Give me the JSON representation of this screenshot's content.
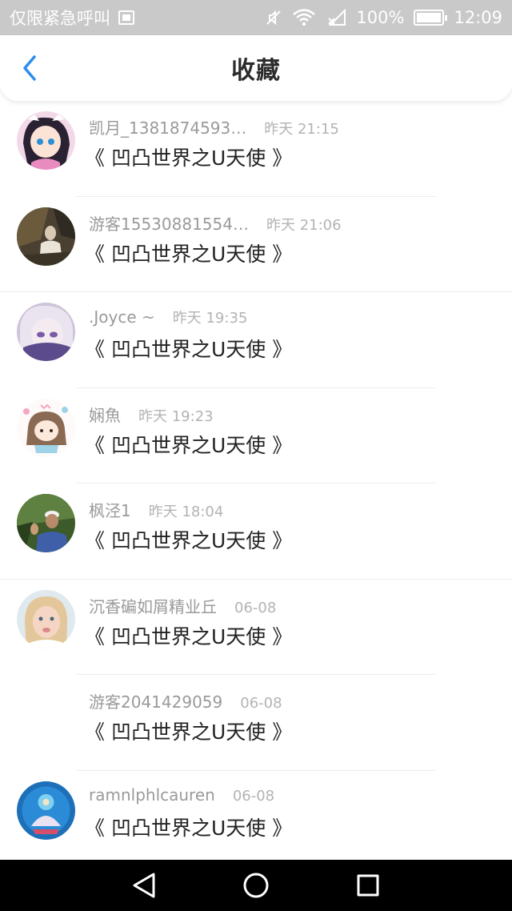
{
  "status_bar": {
    "carrier": "仅限紧急呼叫",
    "battery": "100%",
    "time": "12:09",
    "icons": [
      "sim-icon",
      "mute-icon",
      "wifi-icon",
      "no-signal-icon",
      "battery-icon"
    ]
  },
  "header": {
    "title": "收藏",
    "back_icon": "chevron-left-icon",
    "accent": "#2f8cf0"
  },
  "items": [
    {
      "name": "凯月_1381874593…",
      "time": "昨天 21:15",
      "title": "《 凹凸世界之U天使 》",
      "avatar": "anime-girl-avatar",
      "has_avatar": true
    },
    {
      "name": "游客15530881554…",
      "time": "昨天 21:06",
      "title": "《 凹凸世界之U天使 》",
      "avatar": "photo-avatar",
      "has_avatar": true
    },
    {
      "name": ".Joyce ~",
      "time": "昨天 19:35",
      "title": "《 凹凸世界之U天使 》",
      "avatar": "anime-avatar",
      "has_avatar": true
    },
    {
      "name": "娴魚",
      "time": "昨天 19:23",
      "title": "《 凹凸世界之U天使 》",
      "avatar": "cartoon-avatar",
      "has_avatar": true
    },
    {
      "name": "枫泾1",
      "time": "昨天 18:04",
      "title": "《 凹凸世界之U天使 》",
      "avatar": "man-photo-avatar",
      "has_avatar": true
    },
    {
      "name": "沉香碥如屑精业丘",
      "time": "06-08",
      "title": "《 凹凸世界之U天使 》",
      "avatar": "child-photo-avatar",
      "has_avatar": true
    },
    {
      "name": "游客2041429059",
      "time": "06-08",
      "title": "《 凹凸世界之U天使 》",
      "avatar": "none",
      "has_avatar": false
    },
    {
      "name": "ramnlphlcauren",
      "time": "06-08",
      "title": "《 凹凸世界之U天使 》",
      "avatar": "deity-avatar",
      "has_avatar": true
    }
  ],
  "nav": {
    "icons": [
      "back-triangle-icon",
      "home-circle-icon",
      "recents-square-icon"
    ]
  }
}
